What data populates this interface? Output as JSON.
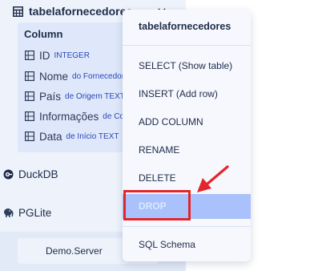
{
  "sidebar": {
    "table_name": "tabelafornecedores",
    "column_heading": "Column",
    "columns": [
      {
        "name": "ID",
        "desc": "INTEGER"
      },
      {
        "name": "Nome",
        "desc": "do Fornecedor"
      },
      {
        "name": "País",
        "desc": "de Origem TEXT"
      },
      {
        "name": "Informações",
        "desc": "de Co"
      },
      {
        "name": "Data",
        "desc": "de Início TEXT"
      }
    ],
    "databases": [
      {
        "name": "DuckDB",
        "icon": "duck-icon"
      },
      {
        "name": "PGLite",
        "icon": "elephant-icon"
      }
    ],
    "server_label": "Demo.Server"
  },
  "context_menu": {
    "title": "tabelafornecedores",
    "items": {
      "select": "SELECT (Show table)",
      "insert": "INSERT (Add row)",
      "add_column": "ADD COLUMN",
      "rename": "RENAME",
      "delete": "DELETE",
      "drop": "DROP",
      "sql_schema": "SQL Schema"
    }
  },
  "colors": {
    "sidebar_bg": "#eef3fb",
    "column_section_bg": "#dfe8fa",
    "drop_row_bg": "#a9c2fb",
    "annotation_red": "#e3262b",
    "type_text": "#2b47b8"
  }
}
